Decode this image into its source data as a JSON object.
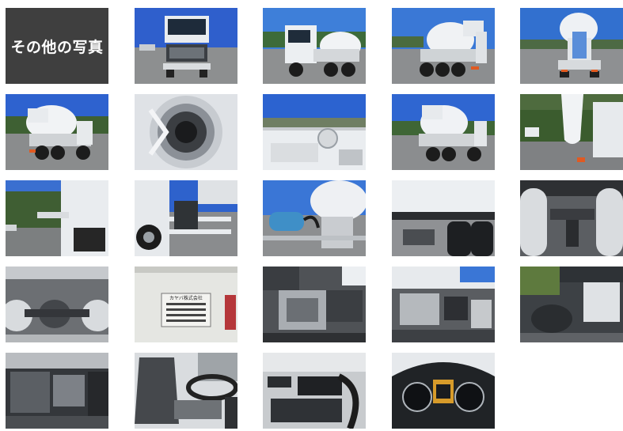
{
  "gallery": {
    "label": "その他の写真",
    "thumbnails": [
      {
        "name": "truck-front-view"
      },
      {
        "name": "truck-front-left-view"
      },
      {
        "name": "truck-rear-right-view"
      },
      {
        "name": "truck-rear-view"
      },
      {
        "name": "truck-rear-left-view"
      },
      {
        "name": "drum-interior-view"
      },
      {
        "name": "drum-logo-closeup"
      },
      {
        "name": "truck-rear-right-view-2"
      },
      {
        "name": "chute-closeup"
      },
      {
        "name": "truck-side-tank-view"
      },
      {
        "name": "truck-side-step-view"
      },
      {
        "name": "water-tank-view"
      },
      {
        "name": "chassis-wheels-view"
      },
      {
        "name": "undercarriage-axles-view"
      },
      {
        "name": "undercarriage-differential-view"
      },
      {
        "name": "manufacturer-plate-view"
      },
      {
        "name": "engine-bay-view"
      },
      {
        "name": "engine-components-view"
      },
      {
        "name": "engine-top-view"
      },
      {
        "name": "engine-detail-view"
      },
      {
        "name": "driver-seat-view"
      },
      {
        "name": "dashboard-center-view"
      },
      {
        "name": "instrument-cluster-view"
      }
    ],
    "plate_text": "カヤバ株式会社"
  },
  "colors": {
    "label_bg": "#3f3f3f",
    "sky": "#2e5fcf",
    "ground": "#8a8c8e",
    "truck_white": "#eef0f2",
    "shadow": "#2a2a2a"
  }
}
